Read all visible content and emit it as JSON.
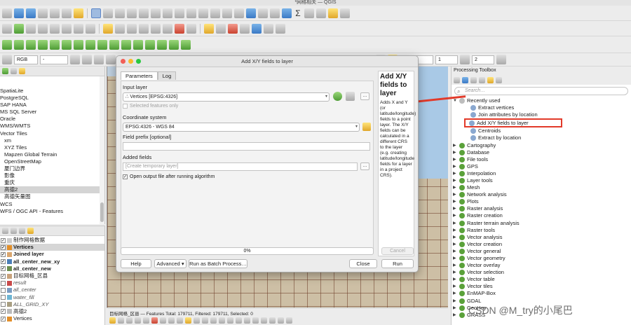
{
  "window": {
    "title": "*网格相关 — QGIS"
  },
  "toolbar": {
    "rgb_select": "RGB",
    "raster_select": "-",
    "spin1": "0",
    "spin2": "1",
    "spin3": "2"
  },
  "browser": {
    "items": [
      "SpatiaLite",
      "PostgreSQL",
      "SAP HANA",
      "MS SQL Server",
      "Oracle",
      "WMS/WMTS",
      "Vector Tiles",
      "xm",
      "XYZ Tiles",
      "Mapzen Global Terrain",
      "OpenStreetMap",
      "厦门边界",
      "影像",
      "重庆",
      "高德2",
      "高德矢量图",
      "WCS",
      "WFS / OGC API - Features"
    ]
  },
  "layers": {
    "items": [
      {
        "label": "制作网格数据",
        "checked": true,
        "color": "#cccccc"
      },
      {
        "label": "Vertices",
        "checked": true,
        "color": "#e28f2a"
      },
      {
        "label": "Joined layer",
        "checked": true,
        "color": "#d9a66f"
      },
      {
        "label": "all_center_new_xy",
        "checked": true,
        "color": "#4c7fb8"
      },
      {
        "label": "all_center_new",
        "checked": true,
        "color": "#6b8e4e"
      },
      {
        "label": "目标网格_区县",
        "checked": true,
        "color": "#c8a27c"
      },
      {
        "label": "result",
        "checked": false,
        "color": "#c94a4a"
      },
      {
        "label": "all_center",
        "checked": false,
        "color": "#7a9bc1"
      },
      {
        "label": "water_fill",
        "checked": false,
        "color": "#6db5d4"
      },
      {
        "label": "ALL_GRID_XY",
        "checked": false,
        "color": "#a89e82"
      },
      {
        "label": "高德2",
        "checked": true,
        "color": "#bbbbbb"
      },
      {
        "label": "Vertices",
        "checked": true,
        "color": "#e28f2a"
      }
    ]
  },
  "dialog": {
    "title": "Add X/Y fields to layer",
    "tabs": [
      "Parameters",
      "Log"
    ],
    "input_layer_label": "Input layer",
    "input_layer_value": "Vertices [EPSG:4326]",
    "selected_only": "Selected features only",
    "crs_label": "Coordinate system",
    "crs_value": "EPSG:4326 - WGS 84",
    "prefix_label": "Field prefix [optional]",
    "added_fields_label": "Added fields",
    "added_fields_placeholder": "[Create temporary layer]",
    "open_output": "Open output file after running algorithm",
    "help_title": "Add X/Y fields to layer",
    "help_text": "Adds X and Y (or latitude/longitude) fields to a point layer. The X/Y fields can be calculated in a different CRS to the layer (e.g. creating latitude/longitude fields for a layer in a project CRS).",
    "progress": "0%",
    "cancel": "Cancel",
    "help_btn": "Help",
    "advanced_btn": "Advanced",
    "batch_btn": "Run as Batch Process…",
    "close_btn": "Close",
    "run_btn": "Run",
    "more": "…"
  },
  "statusbar": {
    "text": "目标网格_区县 — Features Total: 179711, Filtered: 179711, Selected: 0"
  },
  "toolbox": {
    "title": "Processing Toolbox",
    "search_placeholder": "Search…",
    "recent_label": "Recently used",
    "recent": [
      "Extract vertices",
      "Join attributes by location",
      "Add X/Y fields to layer",
      "Centroids",
      "Extract by location"
    ],
    "groups": [
      "Cartography",
      "Database",
      "File tools",
      "GPS",
      "Interpolation",
      "Layer tools",
      "Mesh",
      "Network analysis",
      "Plots",
      "Raster analysis",
      "Raster creation",
      "Raster terrain analysis",
      "Raster tools",
      "Vector analysis",
      "Vector creation",
      "Vector general",
      "Vector geometry",
      "Vector overlay",
      "Vector selection",
      "Vector table",
      "Vector tiles",
      "EnMAP-Box",
      "GDAL",
      "GeoHey",
      "GRASS"
    ]
  },
  "watermark": "CSDN @M_try的小尾巴",
  "colors": {
    "accent": "#e23a2a",
    "canvas": "#cdbfa5"
  }
}
